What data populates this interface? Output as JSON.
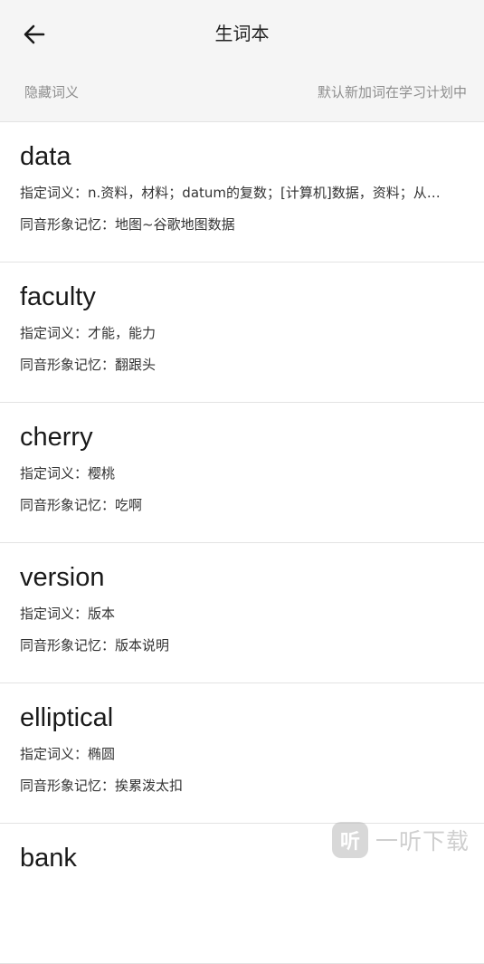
{
  "header": {
    "title": "生词本",
    "hide_meaning": "隐藏词义",
    "default_add": "默认新加词在学习计划中"
  },
  "words": [
    {
      "word": "data",
      "meaning_label": "指定词义：",
      "meaning": "n.资料，材料；datum的复数；[计算机]数据，资料；从…",
      "memory_label": "同音形象记忆：",
      "memory": "地图~谷歌地图数据"
    },
    {
      "word": "faculty",
      "meaning_label": "指定词义：",
      "meaning": "才能，能力",
      "memory_label": "同音形象记忆：",
      "memory": "翻跟头"
    },
    {
      "word": "cherry",
      "meaning_label": "指定词义：",
      "meaning": "樱桃",
      "memory_label": "同音形象记忆：",
      "memory": "吃啊"
    },
    {
      "word": "version",
      "meaning_label": "指定词义：",
      "meaning": "版本",
      "memory_label": "同音形象记忆：",
      "memory": "版本说明"
    },
    {
      "word": "elliptical",
      "meaning_label": "指定词义：",
      "meaning": "椭圆",
      "memory_label": "同音形象记忆：",
      "memory": "挨累泼太扣"
    },
    {
      "word": "bank"
    }
  ],
  "watermark": {
    "logo_glyph": "听",
    "text": "一听下载"
  },
  "icons": {
    "back": "arrow-left-icon"
  }
}
